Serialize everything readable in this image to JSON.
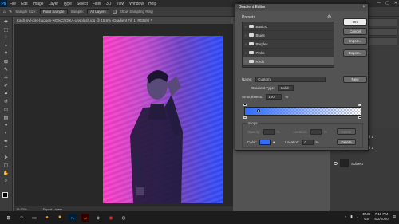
{
  "menubar": {
    "logo": "Ps",
    "items": [
      "File",
      "Edit",
      "Image",
      "Layer",
      "Type",
      "Select",
      "Filter",
      "3D",
      "View",
      "Window",
      "Help"
    ],
    "controls": [
      "—",
      "▢",
      "✕"
    ]
  },
  "options": {
    "sample_size_label": "Sample Size:",
    "sample_size_value": "Point Sample",
    "sample_label": "Sample:",
    "sample_value": "All Layers",
    "show_ring_label": "Show Sampling Ring"
  },
  "document": {
    "tab_title": "Kash-nyf-dire-buquen-w00yChQlKA-unsplash.jpg @ 15.6% (Gradient Fill 1, RGB/8) *",
    "zoom": "15.63%",
    "status": "Export Layers"
  },
  "dialog": {
    "title": "Gradient Editor",
    "presets_label": "Presets",
    "folders": [
      {
        "name": "Basics"
      },
      {
        "name": "Blues"
      },
      {
        "name": "Purples"
      },
      {
        "name": "Pinks"
      },
      {
        "name": "Reds"
      }
    ],
    "buttons": {
      "ok": "OK",
      "cancel": "Cancel",
      "import": "Import...",
      "export": "Export...",
      "new": "New"
    },
    "name_label": "Name:",
    "name_value": "Custom",
    "gradient_type_label": "Gradient Type:",
    "gradient_type_value": "Solid",
    "smoothness_label": "Smoothness:",
    "smoothness_value": "100",
    "smoothness_unit": "%",
    "stops": {
      "label": "Stops",
      "opacity_label": "Opacity:",
      "opacity_unit": "%",
      "location_label": "Location:",
      "location_unit": "%",
      "location_value": "0",
      "color_label": "Color:",
      "delete_label": "Delete",
      "color": "#2f6cff"
    }
  },
  "layers": {
    "items": [
      {
        "name": "Gradient Fill 1"
      },
      {
        "name": "Gradient Fill 1"
      },
      {
        "name": "Subject"
      }
    ]
  },
  "taskbar": {
    "lang": "ENG\nUS",
    "time": "7:11 PM",
    "date": "5/2/2020"
  },
  "colors": {
    "accent": "#2f6cff",
    "pink": "#ff3ec8"
  }
}
